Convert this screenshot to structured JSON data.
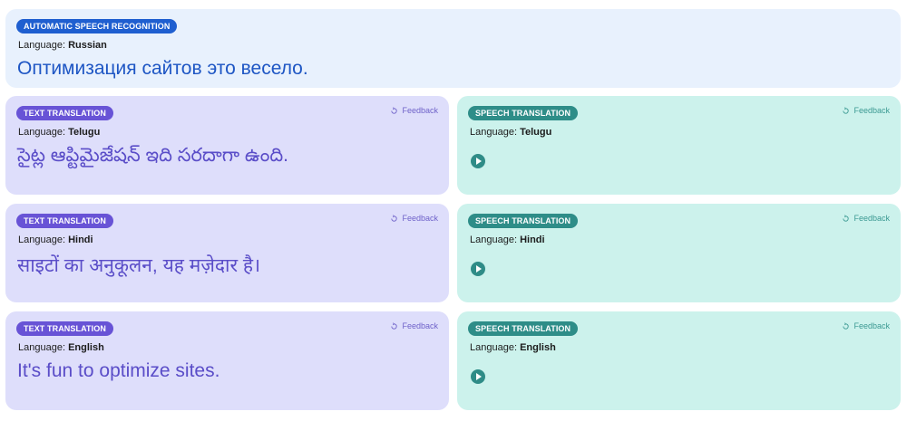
{
  "asr": {
    "badge": "Automatic Speech Recognition",
    "language_prefix": "Language: ",
    "language": "Russian",
    "text": "Оптимизация сайтов это весело."
  },
  "text_translations": [
    {
      "badge": "Text Translation",
      "feedback": "Feedback",
      "language_prefix": "Language: ",
      "language": "Telugu",
      "text": "సైట్ల ఆప్టిమైజేషన్ ఇది సరదాగా ఉంది."
    },
    {
      "badge": "Text Translation",
      "feedback": "Feedback",
      "language_prefix": "Language: ",
      "language": "Hindi",
      "text": "साइटों का अनुकूलन, यह मज़ेदार है।"
    },
    {
      "badge": "Text Translation",
      "feedback": "Feedback",
      "language_prefix": "Language: ",
      "language": "English",
      "text": "It's fun to optimize sites."
    }
  ],
  "speech_translations": [
    {
      "badge": "Speech Translation",
      "feedback": "Feedback",
      "language_prefix": "Language: ",
      "language": "Telugu"
    },
    {
      "badge": "Speech Translation",
      "feedback": "Feedback",
      "language_prefix": "Language: ",
      "language": "Hindi"
    },
    {
      "badge": "Speech Translation",
      "feedback": "Feedback",
      "language_prefix": "Language: ",
      "language": "English"
    }
  ],
  "icons": {
    "feedback": "feedback-icon",
    "play": "play-icon"
  },
  "colors": {
    "asr_bg": "#e8f1fd",
    "asr_accent": "#1f5fd0",
    "text_bg": "#dedefb",
    "text_accent": "#6853d6",
    "speech_bg": "#ccf2ec",
    "speech_accent": "#2e8d88"
  }
}
